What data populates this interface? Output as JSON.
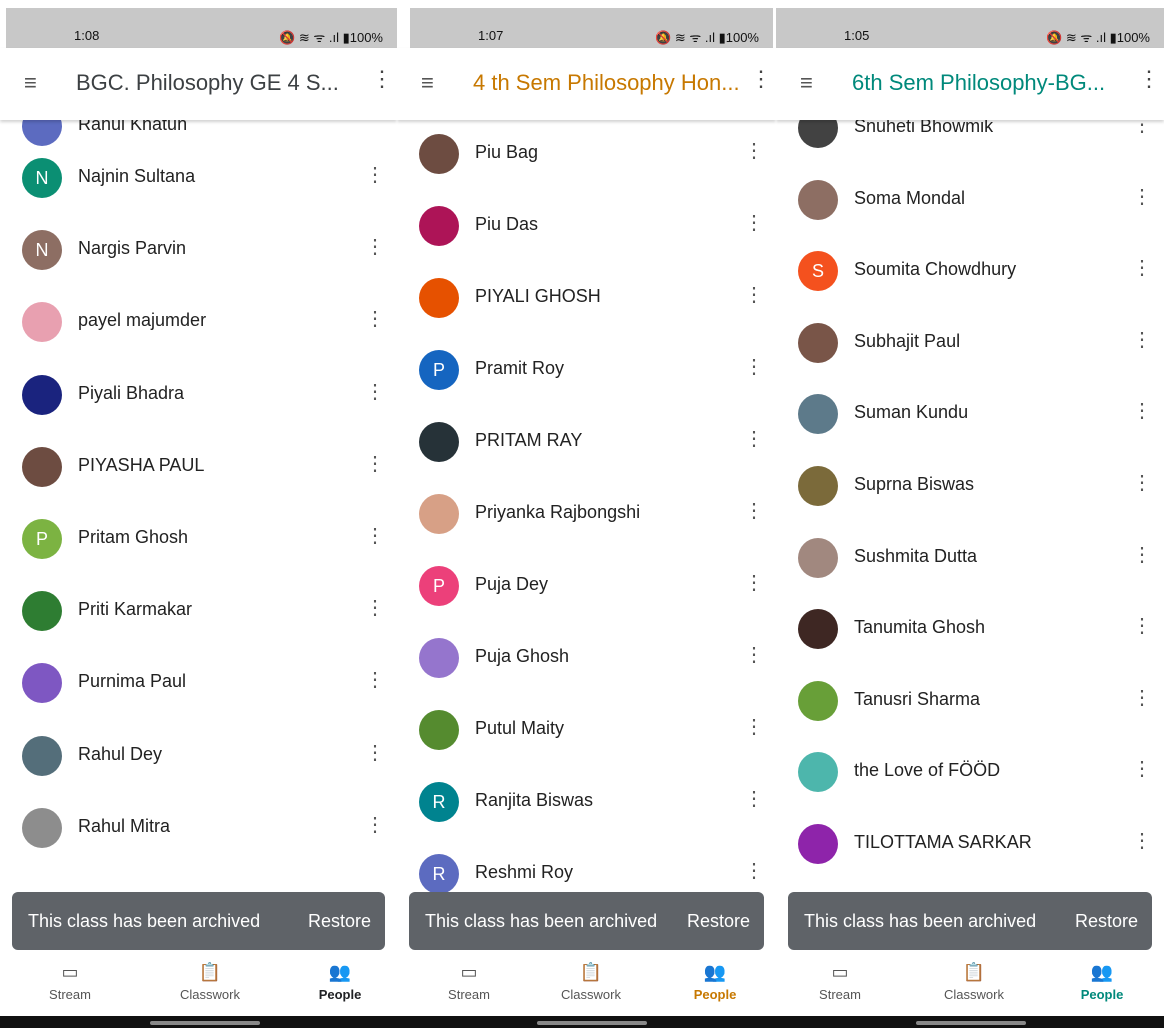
{
  "panels": [
    {
      "status_time": "1:08",
      "status_icons": "🔕 ≋ ᯤ .ıl ▮100%",
      "title": "BGC. Philosophy GE 4 S...",
      "title_color": "#3c4043",
      "accent": "#202124",
      "partial_top": "Rahul Khatun",
      "students": [
        {
          "name": "Najnin Sultana",
          "initial": "N",
          "color": "#0b8f73"
        },
        {
          "name": "Nargis Parvin",
          "initial": "N",
          "color": "#8d6e63"
        },
        {
          "name": "payel majumder",
          "initial": "",
          "color": "#e8a0b0"
        },
        {
          "name": "Piyali Bhadra",
          "initial": "",
          "color": "#1a237e"
        },
        {
          "name": "PIYASHA PAUL",
          "initial": "",
          "color": "#6d4c41"
        },
        {
          "name": "Pritam Ghosh",
          "initial": "P",
          "color": "#7cb342"
        },
        {
          "name": "Priti Karmakar",
          "initial": "",
          "color": "#2e7d32"
        },
        {
          "name": "Purnima Paul",
          "initial": "",
          "color": "#7e57c2"
        },
        {
          "name": "Rahul Dey",
          "initial": "",
          "color": "#546e7a"
        },
        {
          "name": "Rahul Mitra",
          "initial": "",
          "color": "#8d8d8d"
        }
      ],
      "snackbar_msg": "This class has been archived",
      "snackbar_action": "Restore",
      "nav": [
        "Stream",
        "Classwork",
        "People"
      ]
    },
    {
      "status_time": "1:07",
      "status_icons": "🔕 ≋ ᯤ .ıl ▮100%",
      "title": "4 th Sem Philosophy Hon...",
      "title_color": "#c77800",
      "accent": "#c77800",
      "partial_top": "",
      "students": [
        {
          "name": "Piu Bag",
          "initial": "",
          "color": "#6d4c41"
        },
        {
          "name": "Piu Das",
          "initial": "",
          "color": "#ad1457"
        },
        {
          "name": "PIYALI GHOSH",
          "initial": "",
          "color": "#e65100"
        },
        {
          "name": "Pramit Roy",
          "initial": "P",
          "color": "#1565c0"
        },
        {
          "name": "PRITAM RAY",
          "initial": "",
          "color": "#263238"
        },
        {
          "name": "Priyanka Rajbongshi",
          "initial": "",
          "color": "#d7a086"
        },
        {
          "name": "Puja Dey",
          "initial": "P",
          "color": "#ec407a"
        },
        {
          "name": "Puja Ghosh",
          "initial": "",
          "color": "#9575cd"
        },
        {
          "name": "Putul Maity",
          "initial": "",
          "color": "#558b2f"
        },
        {
          "name": "Ranjita Biswas",
          "initial": "R",
          "color": "#00838f"
        },
        {
          "name": "Reshmi Roy",
          "initial": "R",
          "color": "#5c6bc0"
        }
      ],
      "snackbar_msg": "This class has been archived",
      "snackbar_action": "Restore",
      "nav": [
        "Stream",
        "Classwork",
        "People"
      ]
    },
    {
      "status_time": "1:05",
      "status_icons": "🔕 ≋ ᯤ .ıl ▮100%",
      "title": "6th Sem Philosophy-BG...",
      "title_color": "#00897b",
      "accent": "#00897b",
      "partial_top": "",
      "students": [
        {
          "name": "Snuheti Bhowmik",
          "initial": "",
          "color": "#424242"
        },
        {
          "name": "Soma Mondal",
          "initial": "",
          "color": "#8d6e63"
        },
        {
          "name": "Soumita Chowdhury",
          "initial": "S",
          "color": "#f4511e"
        },
        {
          "name": "Subhajit Paul",
          "initial": "",
          "color": "#795548"
        },
        {
          "name": "Suman Kundu",
          "initial": "",
          "color": "#5d7a8a"
        },
        {
          "name": "Suprna Biswas",
          "initial": "",
          "color": "#7b6a3a"
        },
        {
          "name": "Sushmita Dutta",
          "initial": "",
          "color": "#a1887f"
        },
        {
          "name": "Tanumita Ghosh",
          "initial": "",
          "color": "#3e2723"
        },
        {
          "name": "Tanusri Sharma",
          "initial": "",
          "color": "#689f38"
        },
        {
          "name": "the Love of FÖÖD",
          "initial": "",
          "color": "#4db6ac"
        },
        {
          "name": "TILOTTAMA SARKAR",
          "initial": "",
          "color": "#8e24aa"
        }
      ],
      "snackbar_msg": "This class has been archived",
      "snackbar_action": "Restore",
      "nav": [
        "Stream",
        "Classwork",
        "People"
      ]
    }
  ]
}
